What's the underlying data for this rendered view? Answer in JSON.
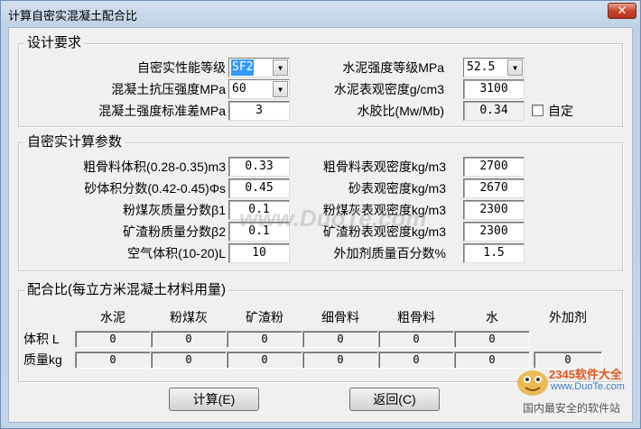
{
  "window": {
    "title": "计算自密实混凝土配合比",
    "close_glyph": "✕"
  },
  "design": {
    "legend": "设计要求",
    "sc_grade_label": "自密实性能等级",
    "sc_grade_value": "SF2",
    "comp_strength_label": "混凝土抗压强度MPa",
    "comp_strength_value": "60",
    "std_dev_label": "混凝土强度标准差MPa",
    "std_dev_value": "3",
    "cement_grade_label": "水泥强度等级MPa",
    "cement_grade_value": "52.5",
    "cement_density_label": "水泥表观密度g/cm3",
    "cement_density_value": "3100",
    "wb_ratio_label": "水胶比(Mw/Mb)",
    "wb_ratio_value": "0.34",
    "custom_label": "自定",
    "dropdown_arrow": "▼"
  },
  "params": {
    "legend": "自密实计算参数",
    "left": [
      {
        "label": "粗骨料体积(0.28-0.35)m3",
        "value": "0.33"
      },
      {
        "label": "砂体积分数(0.42-0.45)Φs",
        "value": "0.45"
      },
      {
        "label": "粉煤灰质量分数β1",
        "value": "0.1"
      },
      {
        "label": "矿渣粉质量分数β2",
        "value": "0.1"
      },
      {
        "label": "空气体积(10-20)L",
        "value": "10"
      }
    ],
    "right": [
      {
        "label": "粗骨料表观密度kg/m3",
        "value": "2700"
      },
      {
        "label": "砂表观密度kg/m3",
        "value": "2670"
      },
      {
        "label": "粉煤灰表观密度kg/m3",
        "value": "2300"
      },
      {
        "label": "矿渣粉表观密度kg/m3",
        "value": "2300"
      },
      {
        "label": "外加剂质量百分数%",
        "value": "1.5"
      }
    ]
  },
  "mix": {
    "legend": "配合比(每立方米混凝土材料用量)",
    "columns": [
      "水泥",
      "粉煤灰",
      "矿渣粉",
      "细骨料",
      "粗骨料",
      "水",
      "外加剂"
    ],
    "volume_label": "体积 L",
    "mass_label": "质量kg",
    "volume_values": [
      "0",
      "0",
      "0",
      "0",
      "0",
      "0"
    ],
    "mass_values": [
      "0",
      "0",
      "0",
      "0",
      "0",
      "0",
      "0"
    ]
  },
  "buttons": {
    "calculate": "计算(E)",
    "back": "返回(C)"
  },
  "watermark": {
    "center_text": "www.DuoTe.com",
    "brand_text": "2345软件大全",
    "brand_url": "www.DuoTe.com",
    "tagline": "国内最安全的软件站"
  }
}
